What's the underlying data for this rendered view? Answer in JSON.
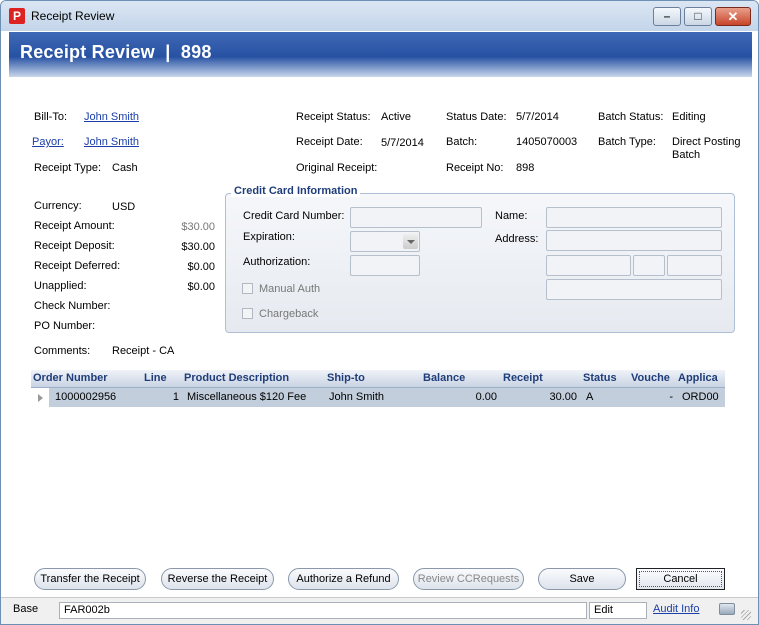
{
  "window": {
    "title": "Receipt Review"
  },
  "header": {
    "title": "Receipt Review  |  898"
  },
  "info": {
    "bill_to_label": "Bill-To:",
    "bill_to": "John Smith",
    "payor_label": "Payor:",
    "payor": "John Smith",
    "receipt_type_label": "Receipt Type:",
    "receipt_type": "Cash",
    "receipt_status_label": "Receipt Status:",
    "receipt_status": "Active",
    "receipt_date_label": "Receipt Date:",
    "receipt_date": "5/7/2014",
    "original_receipt_label": "Original Receipt:",
    "status_date_label": "Status Date:",
    "status_date": "5/7/2014",
    "batch_label": "Batch:",
    "batch": "1405070003",
    "receipt_no_label": "Receipt No:",
    "receipt_no": "898",
    "batch_status_label": "Batch Status:",
    "batch_status": "Editing",
    "batch_type_label": "Batch Type:",
    "batch_type_line1": "Direct Posting",
    "batch_type_line2": "Batch"
  },
  "amounts": {
    "currency_label": "Currency:",
    "currency": "USD",
    "receipt_amount_label": "Receipt Amount:",
    "receipt_amount": "$30.00",
    "receipt_deposit_label": "Receipt Deposit:",
    "receipt_deposit": "$30.00",
    "receipt_deferred_label": "Receipt Deferred:",
    "receipt_deferred": "$0.00",
    "unapplied_label": "Unapplied:",
    "unapplied": "$0.00",
    "check_number_label": "Check Number:",
    "po_number_label": "PO Number:",
    "comments_label": "Comments:",
    "comments": "Receipt - CA"
  },
  "credit_card": {
    "legend": "Credit Card Information",
    "number_label": "Credit Card Number:",
    "expiration_label": "Expiration:",
    "authorization_label": "Authorization:",
    "manual_auth_label": "Manual Auth",
    "chargeback_label": "Chargeback",
    "name_label": "Name:",
    "address_label": "Address:"
  },
  "grid": {
    "columns": [
      "Order Number",
      "Line",
      "Product Description",
      "Ship-to",
      "Balance",
      "Receipt",
      "Status",
      "Vouche",
      "Applica"
    ],
    "rows": [
      {
        "order_number": "1000002956",
        "line": "1",
        "product": "Miscellaneous $120 Fee",
        "ship_to": "John Smith",
        "balance": "0.00",
        "receipt": "30.00",
        "status": "A",
        "voucher": "-",
        "applied": "ORD00"
      }
    ]
  },
  "buttons": {
    "transfer": "Transfer the Receipt",
    "reverse": "Reverse the Receipt",
    "authorize": "Authorize a Refund",
    "review_cc": "Review CCRequests",
    "save": "Save",
    "cancel": "Cancel"
  },
  "statusbar": {
    "mode": "Base",
    "form": "FAR002b",
    "state": "Edit",
    "audit": "Audit Info"
  }
}
